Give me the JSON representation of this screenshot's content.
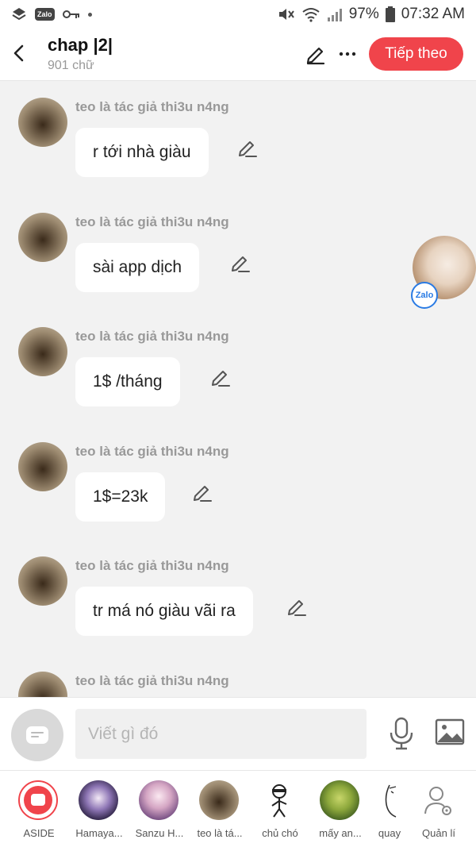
{
  "status": {
    "battery": "97%",
    "time": "07:32 AM",
    "app_badge": "Zalo"
  },
  "header": {
    "title": "chap |2|",
    "subtitle": "901 chữ",
    "next_button": "Tiếp theo"
  },
  "messages": [
    {
      "sender": "teo là tác giả thi3u n4ng",
      "text": "r tới nhà giàu"
    },
    {
      "sender": "teo là tác giả thi3u n4ng",
      "text": "sài app dịch"
    },
    {
      "sender": "teo là tác giả thi3u n4ng",
      "text": "1$ /tháng"
    },
    {
      "sender": "teo là tác giả thi3u n4ng",
      "text": "1$=23k"
    },
    {
      "sender": "teo là tác giả thi3u n4ng",
      "text": "tr má nó giàu vãi ra"
    },
    {
      "sender": "teo là tác giả thi3u n4ng",
      "text": ""
    }
  ],
  "floating": {
    "badge": "Zalo"
  },
  "composer": {
    "placeholder": "Viết gì đó"
  },
  "nav": [
    {
      "label": "ASIDE"
    },
    {
      "label": "Hamaya..."
    },
    {
      "label": "Sanzu H..."
    },
    {
      "label": "teo là tá..."
    },
    {
      "label": "chủ chó"
    },
    {
      "label": "mấy an..."
    },
    {
      "label": "quay"
    },
    {
      "label": "Quản lí"
    }
  ]
}
